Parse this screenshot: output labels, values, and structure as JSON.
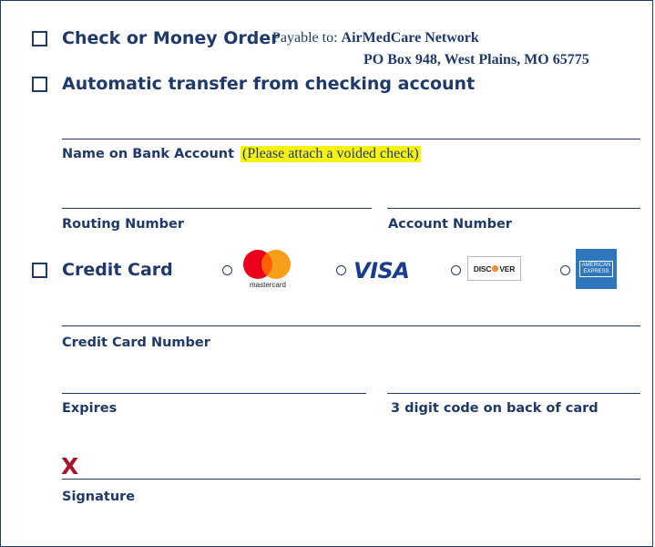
{
  "payment": {
    "check_label": "Check or Money Order",
    "payable_prefix": "Payable to:",
    "payee_name": "AirMedCare Network",
    "payee_address": "PO Box 948, West Plains, MO 65775",
    "auto_transfer_label": "Automatic transfer from checking account",
    "bank_name_label": "Name on Bank Account",
    "voided_check_note": "(Please attach a voided check)",
    "routing_label": "Routing Number",
    "account_label": "Account Number",
    "credit_card_label": "Credit Card",
    "card_number_label": "Credit Card Number",
    "expires_label": "Expires",
    "cvv_label": "3 digit code on back of card",
    "signature_mark": "X",
    "signature_label": "Signature"
  },
  "cards": {
    "mastercard": "mastercard",
    "visa": "VISA",
    "discover_left": "DISC",
    "discover_right": "VER",
    "amex_line1": "AMERICAN",
    "amex_line2": "EXPRESS"
  },
  "colors": {
    "navy": "#1f3a68",
    "highlight": "#f7f211",
    "signature_x": "#a3162b"
  }
}
